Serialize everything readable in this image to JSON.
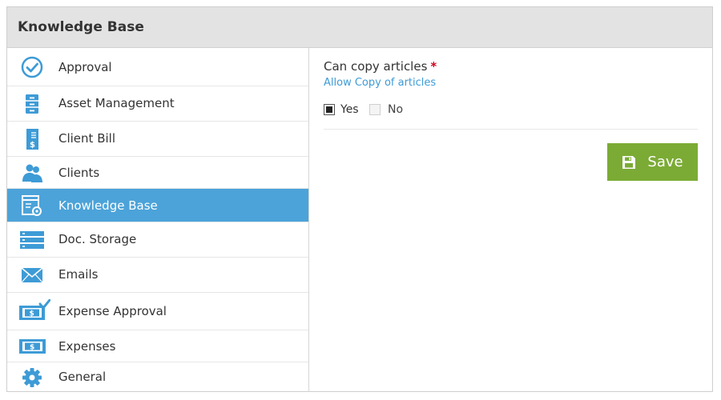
{
  "panel": {
    "title": "Knowledge Base"
  },
  "sidebar": {
    "items": [
      {
        "label": "Approval",
        "icon": "approval-check-icon"
      },
      {
        "label": "Asset Management",
        "icon": "asset-cabinet-icon"
      },
      {
        "label": "Client Bill",
        "icon": "client-bill-icon"
      },
      {
        "label": "Clients",
        "icon": "clients-icon"
      },
      {
        "label": "Knowledge Base",
        "icon": "knowledge-base-icon",
        "active": true
      },
      {
        "label": "Doc. Storage",
        "icon": "doc-storage-icon"
      },
      {
        "label": "Emails",
        "icon": "email-envelope-icon"
      },
      {
        "label": "Expense Approval",
        "icon": "expense-approval-icon"
      },
      {
        "label": "Expenses",
        "icon": "expenses-money-icon"
      },
      {
        "label": "General",
        "icon": "general-gear-icon"
      }
    ]
  },
  "form": {
    "field_label": "Can copy articles",
    "required_mark": "*",
    "help_text": "Allow Copy of articles",
    "options": [
      {
        "label": "Yes",
        "checked": true
      },
      {
        "label": "No",
        "checked": false
      }
    ],
    "save_label": "Save"
  },
  "colors": {
    "active_bg": "#4ca3d9",
    "icon_blue": "#3d9bd6",
    "save_green": "#7bab35",
    "required_red": "#d0021b",
    "link_blue": "#3d9bd6"
  }
}
